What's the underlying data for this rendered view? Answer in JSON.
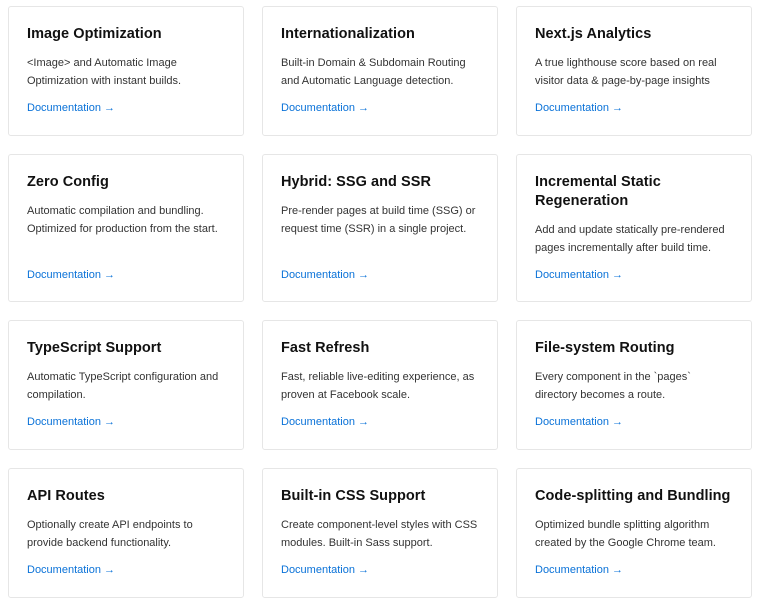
{
  "cards": [
    {
      "title": "Image Optimization",
      "description": "<Image> and Automatic Image Optimization with instant builds.",
      "link": "Documentation",
      "arrow": "→"
    },
    {
      "title": "Internationalization",
      "description": "Built-in Domain & Subdomain Routing and Automatic Language detection.",
      "link": "Documentation",
      "arrow": "→"
    },
    {
      "title": "Next.js Analytics",
      "description": "A true lighthouse score based on real visitor data & page-by-page insights",
      "link": "Documentation",
      "arrow": "→"
    },
    {
      "title": "Zero Config",
      "description": "Automatic compilation and bundling. Optimized for production from the start.",
      "link": "Documentation",
      "arrow": "→"
    },
    {
      "title": "Hybrid: SSG and SSR",
      "description": "Pre-render pages at build time (SSG) or request time (SSR) in a single project.",
      "link": "Documentation",
      "arrow": "→"
    },
    {
      "title": "Incremental Static Regeneration",
      "description": "Add and update statically pre-rendered pages incrementally after build time.",
      "link": "Documentation",
      "arrow": "→"
    },
    {
      "title": "TypeScript Support",
      "description": "Automatic TypeScript configuration and compilation.",
      "link": "Documentation",
      "arrow": "→"
    },
    {
      "title": "Fast Refresh",
      "description": "Fast, reliable live-editing experience, as proven at Facebook scale.",
      "link": "Documentation",
      "arrow": "→"
    },
    {
      "title": "File-system Routing",
      "description": "Every component in the `pages` directory becomes a route.",
      "link": "Documentation",
      "arrow": "→"
    },
    {
      "title": "API Routes",
      "description": "Optionally create API endpoints to provide backend functionality.",
      "link": "Documentation",
      "arrow": "→"
    },
    {
      "title": "Built-in CSS Support",
      "description": "Create component-level styles with CSS modules. Built-in Sass support.",
      "link": "Documentation",
      "arrow": "→"
    },
    {
      "title": "Code-splitting and Bundling",
      "description": "Optimized bundle splitting algorithm created by the Google Chrome team.",
      "link": "Documentation",
      "arrow": "→"
    }
  ],
  "colors": {
    "link": "#0a72d8",
    "border": "#e6e6e6",
    "title": "#111111",
    "text": "#333333"
  }
}
